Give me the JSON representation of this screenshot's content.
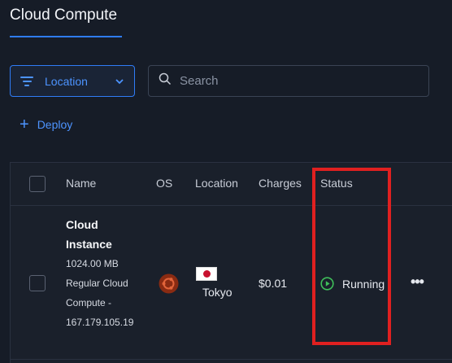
{
  "page": {
    "title": "Cloud Compute"
  },
  "toolbar": {
    "location_filter_label": "Location",
    "search_placeholder": "Search",
    "deploy_label": "Deploy"
  },
  "table": {
    "columns": [
      "Name",
      "OS",
      "Location",
      "Charges",
      "Status"
    ],
    "rows": [
      {
        "name": "Cloud Instance",
        "memory": "1024.00 MB",
        "plan": "Regular Cloud Compute -",
        "ip": "167.179.105.19",
        "os_icon": "ubuntu-icon",
        "location_flag": "japan-flag-icon",
        "location": "Tokyo",
        "charges": "$0.01",
        "status": "Running",
        "status_icon": "play-circle-icon"
      }
    ]
  },
  "colors": {
    "background": "#161c27",
    "accent": "#2f7cf6",
    "status_running": "#3fbf5a",
    "highlight": "#e02020",
    "ubuntu": "#8a2b12"
  }
}
